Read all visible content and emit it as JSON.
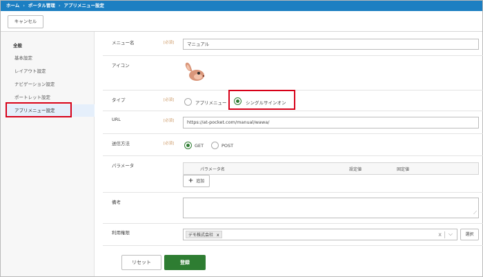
{
  "breadcrumb": [
    "ホーム",
    "ポータル管理",
    "アプリメニュー設定"
  ],
  "breadcrumb_separator": "›",
  "toolbar": {
    "cancel_label": "キャンセル"
  },
  "sidebar": {
    "title": "全般",
    "items": [
      {
        "label": "基本設定"
      },
      {
        "label": "レイアウト設定"
      },
      {
        "label": "ナビゲーション設定"
      },
      {
        "label": "ポートレット設定"
      },
      {
        "label": "アプリメニュー設定",
        "active": true
      }
    ]
  },
  "form": {
    "required_tag": "[必須]",
    "menu_name": {
      "label": "メニュー名",
      "value": "マニュアル"
    },
    "icon": {
      "label": "アイコン",
      "icon_name": "rabbit-icon"
    },
    "type": {
      "label": "タイプ",
      "options": [
        "アプリメニュー",
        "シングルサインオン"
      ],
      "selected": "シングルサインオン"
    },
    "url": {
      "label": "URL",
      "value": "https://at-pocket.com/manual/wawa/"
    },
    "method": {
      "label": "送信方法",
      "options": [
        "GET",
        "POST"
      ],
      "selected": "GET"
    },
    "params": {
      "label": "パラメータ",
      "columns": [
        "パラメータ名",
        "設定値",
        "固定値"
      ],
      "add_label": "追加"
    },
    "notes": {
      "label": "備考",
      "value": ""
    },
    "permission": {
      "label": "利用権限",
      "chips": [
        {
          "label": "デモ株式会社",
          "remove": "x"
        }
      ],
      "clear_glyph": "x",
      "choose_label": "選択"
    }
  },
  "actions": {
    "reset_label": "リセット",
    "register_label": "登録"
  },
  "colors": {
    "header": "#1c7fc2",
    "highlight_box": "#d70018",
    "primary_button": "#2e7d32"
  }
}
